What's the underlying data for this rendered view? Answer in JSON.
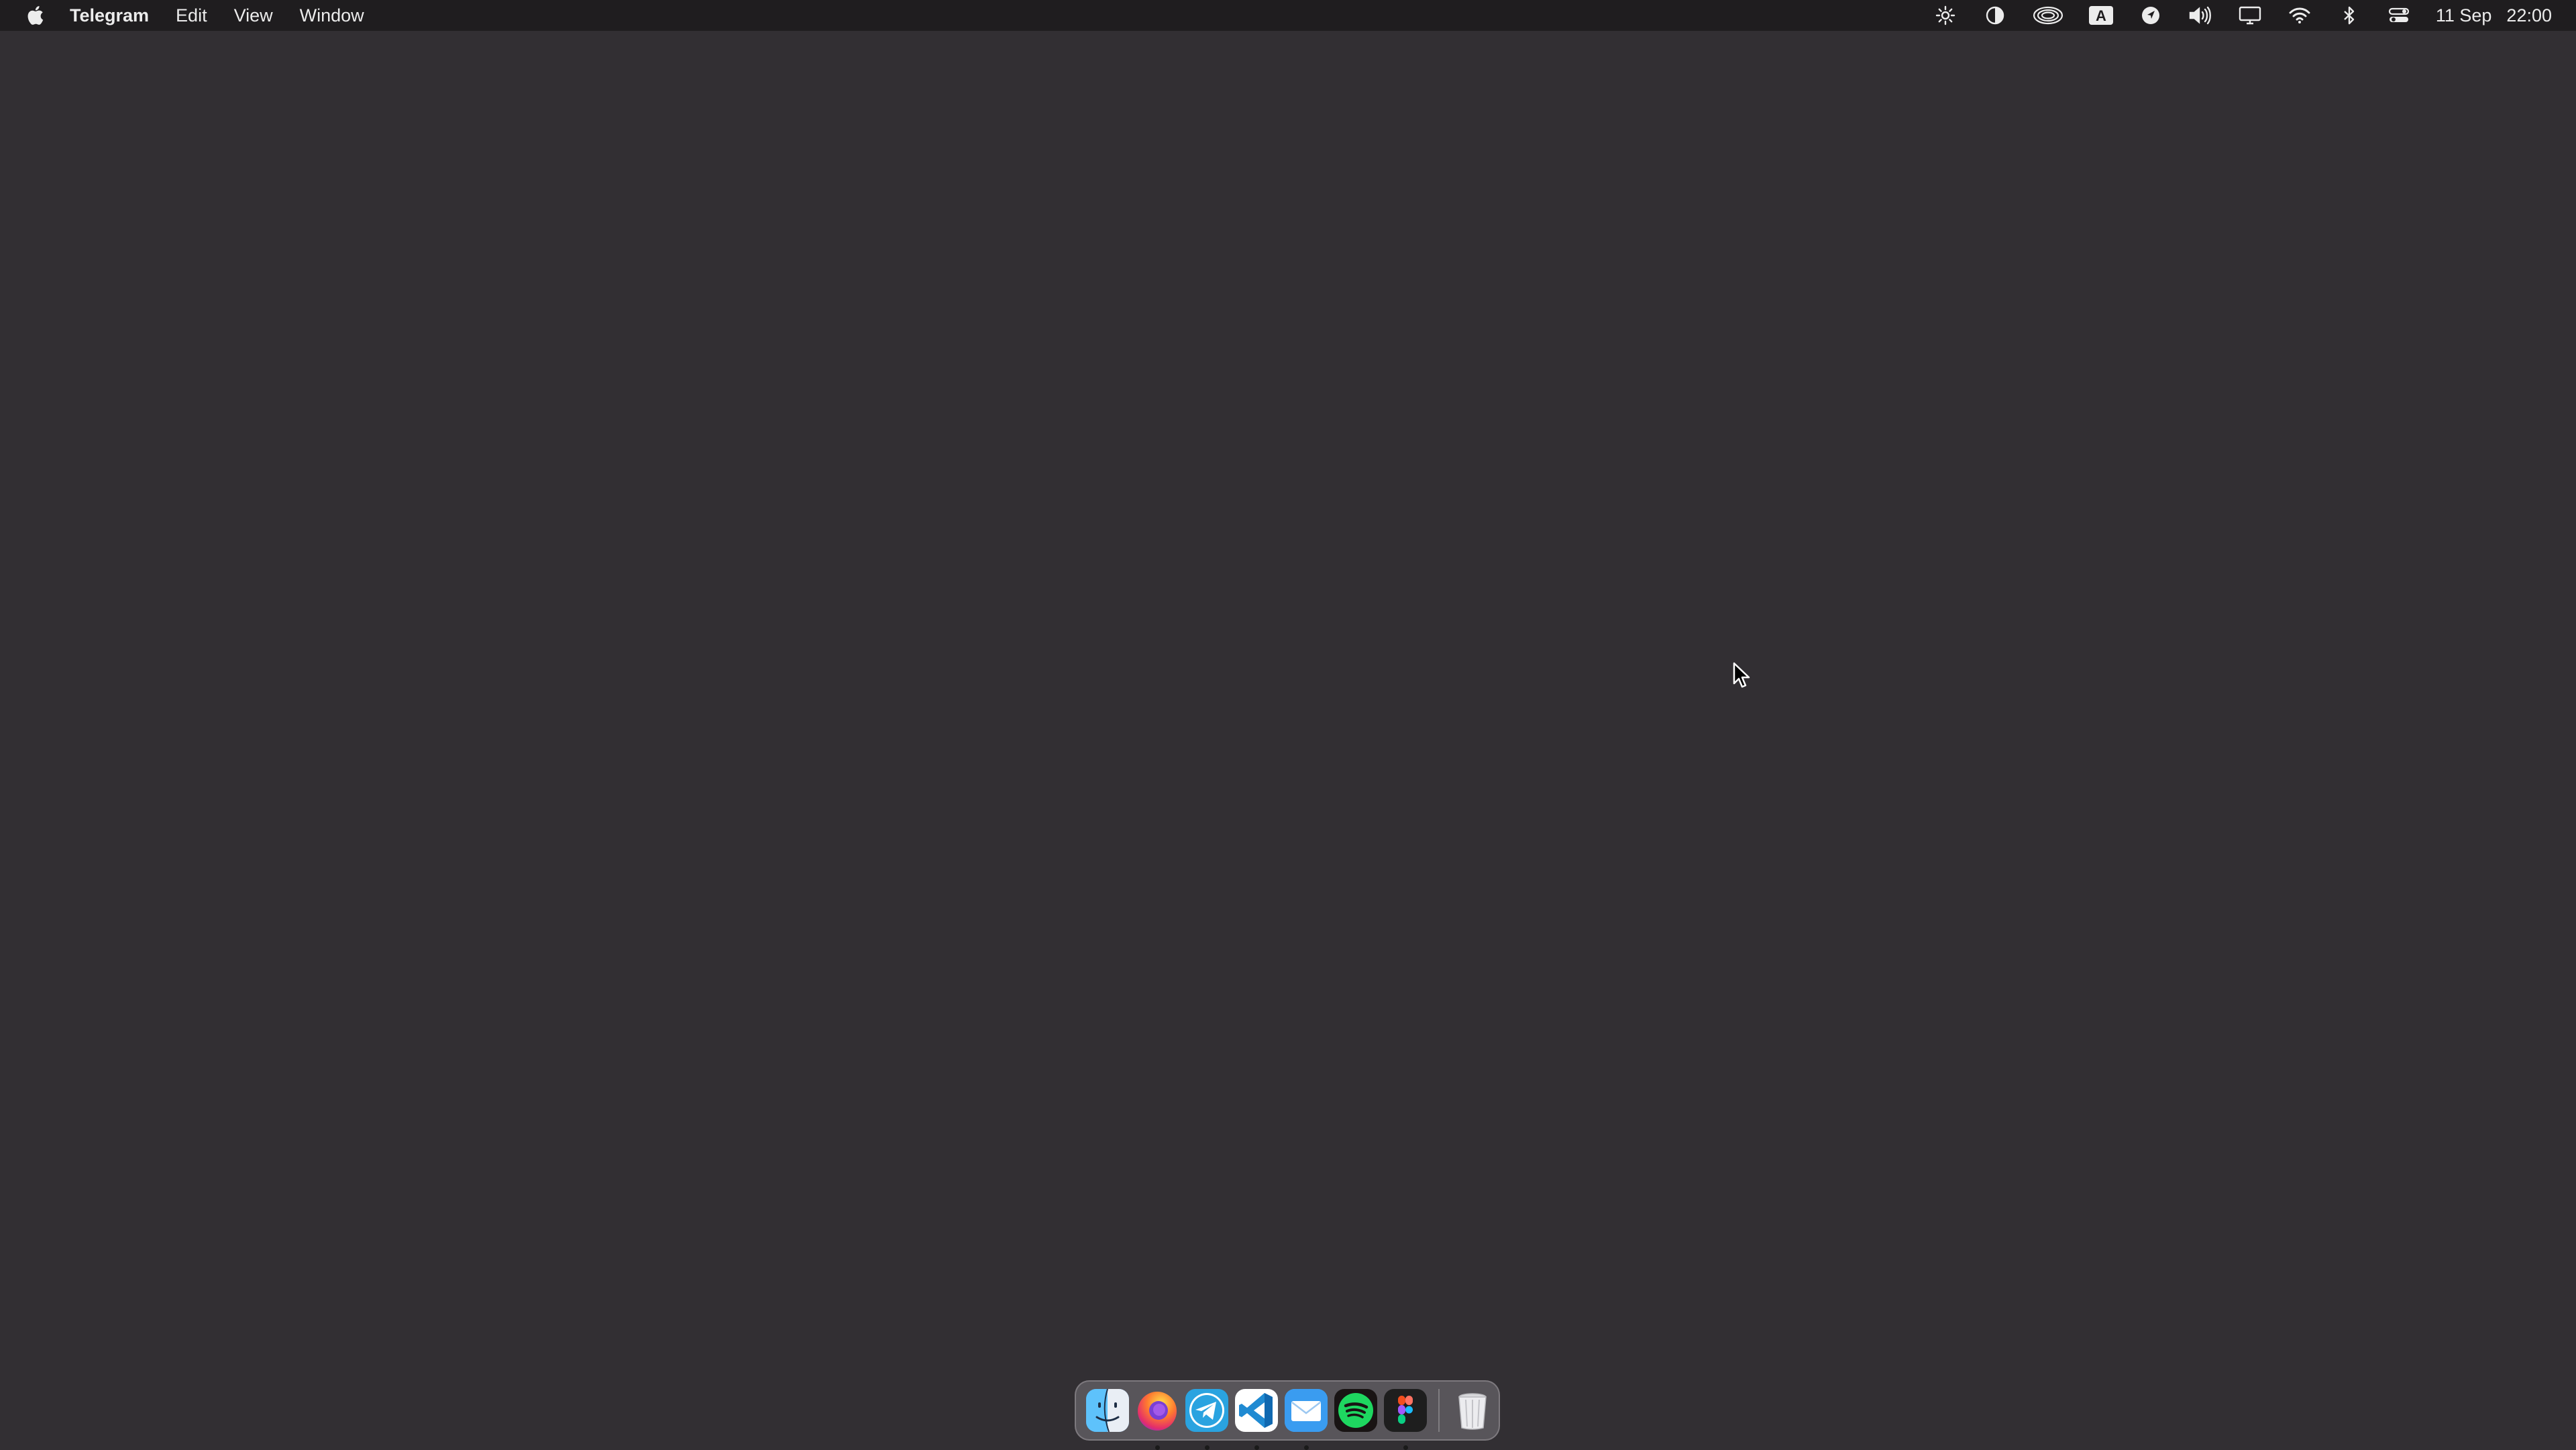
{
  "menubar": {
    "apple_icon": "apple-logo-icon",
    "app_name": "Telegram",
    "menus": [
      "Edit",
      "View",
      "Window"
    ],
    "status_icons": [
      "brightness-icon",
      "dark-mode-icon",
      "airdrop-icon",
      "input-source-icon",
      "location-icon",
      "volume-icon",
      "display-icon",
      "wifi-icon",
      "bluetooth-icon",
      "control-center-icon"
    ],
    "input_source_label": "A",
    "date": "11 Sep",
    "time": "22:00"
  },
  "dock": {
    "apps": [
      {
        "name": "Finder",
        "icon": "finder-icon",
        "running": false
      },
      {
        "name": "Firefox",
        "icon": "firefox-icon",
        "running": true
      },
      {
        "name": "Telegram",
        "icon": "telegram-icon",
        "running": true
      },
      {
        "name": "Visual Studio Code",
        "icon": "vscode-icon",
        "running": true
      },
      {
        "name": "Mail",
        "icon": "mail-icon",
        "running": true
      },
      {
        "name": "Spotify",
        "icon": "spotify-icon",
        "running": false
      },
      {
        "name": "Figma",
        "icon": "figma-icon",
        "running": true
      }
    ],
    "trash_icon": "trash-icon"
  },
  "colors": {
    "desktop": "#322f33",
    "menubar": "#1f1d1f",
    "telegram": "#2aa3e0",
    "spotify": "#1ed760",
    "vscode": "#1f8ad2"
  }
}
